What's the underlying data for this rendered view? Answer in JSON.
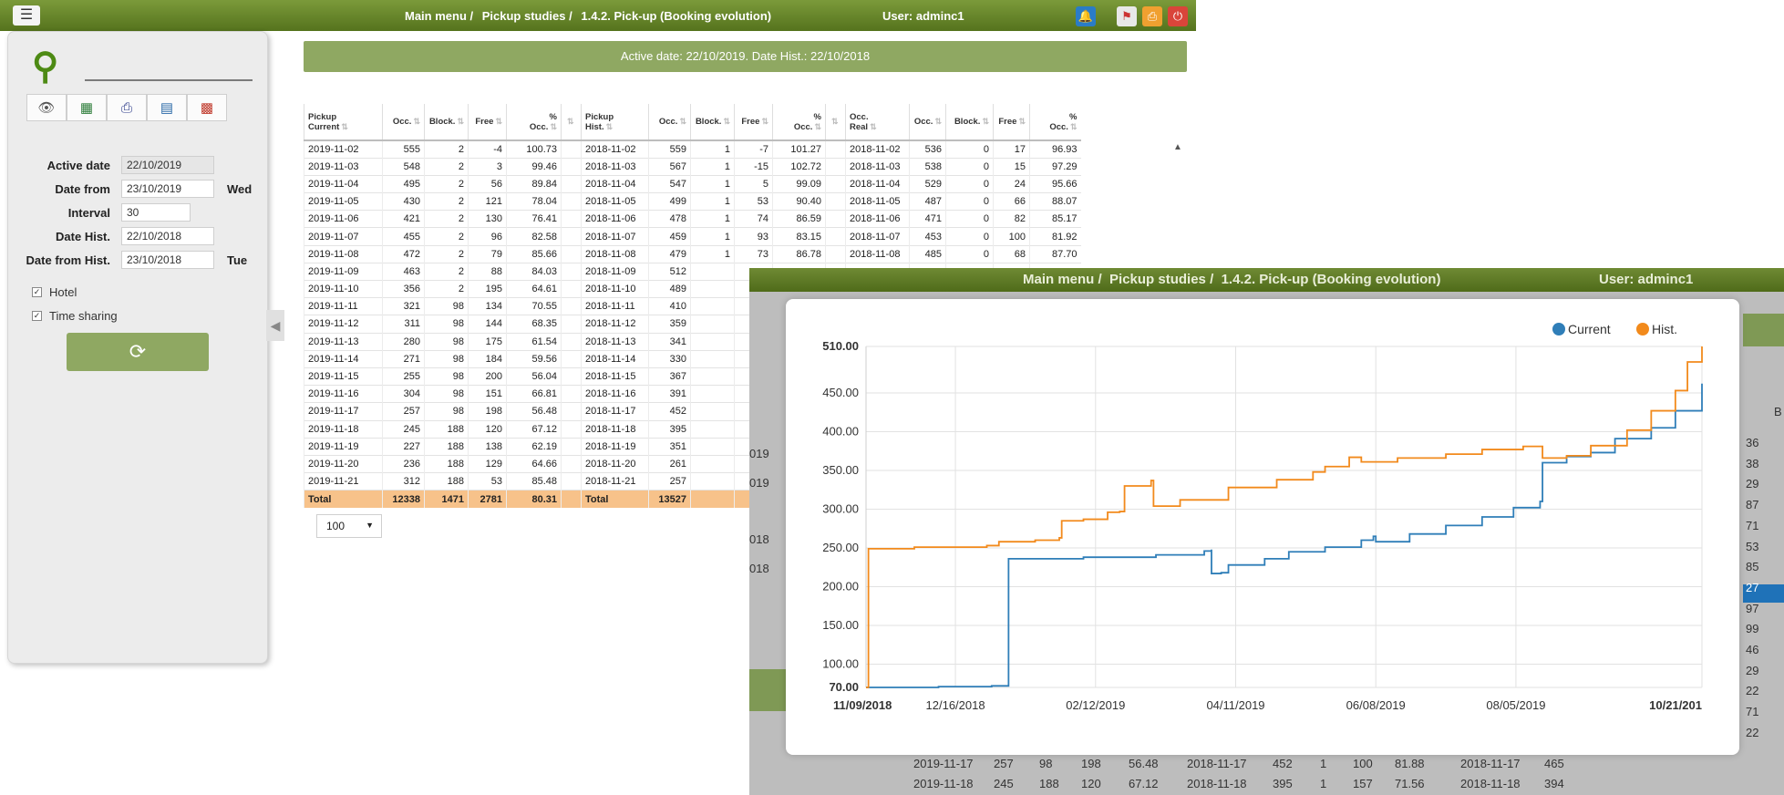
{
  "topbar": {
    "menu_icon": "hamburger-icon",
    "crumb_main": "Main menu /",
    "crumb_pickup": "Pickup studies /",
    "crumb_page": "1.4.2. Pick-up (Booking evolution)",
    "user": "User: adminc1",
    "icons": [
      "bell-icon",
      "flag-icon",
      "print-icon",
      "power-icon"
    ],
    "colors": {
      "bell": "#2a7cc7",
      "flag": "#e8e8e8",
      "print": "#f0a030",
      "power": "#d9453a"
    }
  },
  "filters": {
    "search_value": "",
    "toolbar_icons": [
      "eye-icon",
      "excel-icon",
      "printer-icon",
      "scanner-icon",
      "pdf-icon"
    ],
    "active_date_label": "Active date",
    "active_date": "22/10/2019",
    "date_from_label": "Date from",
    "date_from": "23/10/2019",
    "date_from_day": "Wed",
    "interval_label": "Interval",
    "interval": "30",
    "date_hist_label": "Date Hist.",
    "date_hist": "22/10/2018",
    "date_from_hist_label": "Date from Hist.",
    "date_from_hist": "23/10/2018",
    "date_from_hist_day": "Tue",
    "hotel_label": "Hotel",
    "timesharing_label": "Time sharing"
  },
  "banner": "Active date: 22/10/2019. Date Hist.: 22/10/2018",
  "table": {
    "headers": [
      [
        "Pickup",
        "Current"
      ],
      [
        "",
        "Occ."
      ],
      [
        "",
        "Block."
      ],
      [
        "",
        "Free"
      ],
      [
        "%",
        "Occ."
      ],
      [
        "",
        ""
      ],
      [
        "Pickup",
        "Hist."
      ],
      [
        "",
        "Occ."
      ],
      [
        "",
        "Block."
      ],
      [
        "",
        "Free"
      ],
      [
        "%",
        "Occ."
      ],
      [
        "",
        ""
      ],
      [
        "Occ.",
        "Real"
      ],
      [
        "",
        "Occ."
      ],
      [
        "",
        "Block."
      ],
      [
        "",
        "Free"
      ],
      [
        "%",
        "Occ."
      ]
    ],
    "rows": [
      [
        "2019-11-02",
        "555",
        "2",
        "-4",
        "100.73",
        "",
        "2018-11-02",
        "559",
        "1",
        "-7",
        "101.27",
        "",
        "2018-11-02",
        "536",
        "0",
        "17",
        "96.93"
      ],
      [
        "2019-11-03",
        "548",
        "2",
        "3",
        "99.46",
        "",
        "2018-11-03",
        "567",
        "1",
        "-15",
        "102.72",
        "",
        "2018-11-03",
        "538",
        "0",
        "15",
        "97.29"
      ],
      [
        "2019-11-04",
        "495",
        "2",
        "56",
        "89.84",
        "",
        "2018-11-04",
        "547",
        "1",
        "5",
        "99.09",
        "",
        "2018-11-04",
        "529",
        "0",
        "24",
        "95.66"
      ],
      [
        "2019-11-05",
        "430",
        "2",
        "121",
        "78.04",
        "",
        "2018-11-05",
        "499",
        "1",
        "53",
        "90.40",
        "",
        "2018-11-05",
        "487",
        "0",
        "66",
        "88.07"
      ],
      [
        "2019-11-06",
        "421",
        "2",
        "130",
        "76.41",
        "",
        "2018-11-06",
        "478",
        "1",
        "74",
        "86.59",
        "",
        "2018-11-06",
        "471",
        "0",
        "82",
        "85.17"
      ],
      [
        "2019-11-07",
        "455",
        "2",
        "96",
        "82.58",
        "",
        "2018-11-07",
        "459",
        "1",
        "93",
        "83.15",
        "",
        "2018-11-07",
        "453",
        "0",
        "100",
        "81.92"
      ],
      [
        "2019-11-08",
        "472",
        "2",
        "79",
        "85.66",
        "",
        "2018-11-08",
        "479",
        "1",
        "73",
        "86.78",
        "",
        "2018-11-08",
        "485",
        "0",
        "68",
        "87.70"
      ],
      [
        "2019-11-09",
        "463",
        "2",
        "88",
        "84.03",
        "",
        "2018-11-09",
        "512",
        "",
        "",
        "",
        "",
        "",
        "",
        "",
        "",
        ""
      ],
      [
        "2019-11-10",
        "356",
        "2",
        "195",
        "64.61",
        "",
        "2018-11-10",
        "489",
        "",
        "",
        "",
        "",
        "",
        "",
        "",
        "",
        ""
      ],
      [
        "2019-11-11",
        "321",
        "98",
        "134",
        "70.55",
        "",
        "2018-11-11",
        "410",
        "",
        "",
        "",
        "",
        "",
        "",
        "",
        "",
        ""
      ],
      [
        "2019-11-12",
        "311",
        "98",
        "144",
        "68.35",
        "",
        "2018-11-12",
        "359",
        "",
        "",
        "",
        "",
        "",
        "",
        "",
        "",
        ""
      ],
      [
        "2019-11-13",
        "280",
        "98",
        "175",
        "61.54",
        "",
        "2018-11-13",
        "341",
        "",
        "",
        "",
        "",
        "",
        "",
        "",
        "",
        ""
      ],
      [
        "2019-11-14",
        "271",
        "98",
        "184",
        "59.56",
        "",
        "2018-11-14",
        "330",
        "",
        "",
        "",
        "",
        "",
        "",
        "",
        "",
        ""
      ],
      [
        "2019-11-15",
        "255",
        "98",
        "200",
        "56.04",
        "",
        "2018-11-15",
        "367",
        "",
        "",
        "",
        "",
        "",
        "",
        "",
        "",
        ""
      ],
      [
        "2019-11-16",
        "304",
        "98",
        "151",
        "66.81",
        "",
        "2018-11-16",
        "391",
        "",
        "",
        "",
        "",
        "",
        "",
        "",
        "",
        ""
      ],
      [
        "2019-11-17",
        "257",
        "98",
        "198",
        "56.48",
        "",
        "2018-11-17",
        "452",
        "",
        "",
        "",
        "",
        "",
        "",
        "",
        "",
        ""
      ],
      [
        "2019-11-18",
        "245",
        "188",
        "120",
        "67.12",
        "",
        "2018-11-18",
        "395",
        "",
        "",
        "",
        "",
        "",
        "",
        "",
        "",
        ""
      ],
      [
        "2019-11-19",
        "227",
        "188",
        "138",
        "62.19",
        "",
        "2018-11-19",
        "351",
        "",
        "",
        "",
        "",
        "",
        "",
        "",
        "",
        ""
      ],
      [
        "2019-11-20",
        "236",
        "188",
        "129",
        "64.66",
        "",
        "2018-11-20",
        "261",
        "",
        "",
        "",
        "",
        "",
        "",
        "",
        "",
        ""
      ],
      [
        "2019-11-21",
        "312",
        "188",
        "53",
        "85.48",
        "",
        "2018-11-21",
        "257",
        "",
        "",
        "",
        "",
        "",
        "",
        "",
        "",
        ""
      ]
    ],
    "total": [
      "Total",
      "12338",
      "1471",
      "2781",
      "80.31",
      "",
      "Total",
      "13527",
      "",
      "",
      "",
      "",
      "",
      "",
      "",
      "",
      ""
    ],
    "page_size": "100"
  },
  "popup": {
    "crumb_main": "Main menu /",
    "crumb_pickup": "Pickup studies /",
    "crumb_page": "1.4.2. Pick-up (Booking evolution)",
    "user": "User: adminc1",
    "bg_left": [
      "019",
      "019",
      "018",
      "018"
    ],
    "bg_right": [
      "36",
      "38",
      "29",
      "87",
      "71",
      "53",
      "85",
      "27",
      "97",
      "99",
      "46",
      "29",
      "22",
      "71",
      "22"
    ],
    "bg_header_b": "B",
    "bg_rows": [
      [
        "2019-11-17",
        "257",
        "98",
        "198",
        "56.48",
        "2018-11-17",
        "452",
        "1",
        "100",
        "81.88",
        "2018-11-17",
        "465"
      ],
      [
        "2019-11-18",
        "245",
        "188",
        "120",
        "67.12",
        "2018-11-18",
        "395",
        "1",
        "157",
        "71.56",
        "2018-11-18",
        "394"
      ]
    ]
  },
  "chart_data": {
    "type": "line",
    "legend": [
      "Current",
      "Hist."
    ],
    "legend_position": "top-right",
    "colors": {
      "Current": "#2f7eb8",
      "Hist.": "#f28a1c"
    },
    "y_ticks": [
      "510.00",
      "450.00",
      "400.00",
      "350.00",
      "300.00",
      "250.00",
      "200.00",
      "150.00",
      "100.00",
      "70.00"
    ],
    "y_tick_values": [
      510,
      450,
      400,
      350,
      300,
      250,
      200,
      150,
      100,
      70
    ],
    "ylim": [
      70,
      510
    ],
    "x_ticks": [
      "11/09/2018",
      "12/16/2018",
      "02/12/2019",
      "04/11/2019",
      "06/08/2019",
      "08/05/2019",
      "10/21/201"
    ],
    "x_tick_days": [
      0,
      37,
      95,
      153,
      211,
      269,
      346
    ],
    "xlim_days": [
      0,
      346
    ],
    "grid": true,
    "series": [
      {
        "name": "Current",
        "points": [
          [
            0,
            70
          ],
          [
            10,
            70
          ],
          [
            30,
            71
          ],
          [
            52,
            72
          ],
          [
            58,
            72
          ],
          [
            59,
            236
          ],
          [
            90,
            238
          ],
          [
            120,
            241
          ],
          [
            140,
            246
          ],
          [
            143,
            248
          ],
          [
            143,
            217
          ],
          [
            147,
            218
          ],
          [
            150,
            228
          ],
          [
            165,
            236
          ],
          [
            175,
            245
          ],
          [
            190,
            251
          ],
          [
            205,
            260
          ],
          [
            210,
            265
          ],
          [
            211,
            258
          ],
          [
            225,
            268
          ],
          [
            240,
            279
          ],
          [
            255,
            290
          ],
          [
            268,
            302
          ],
          [
            279,
            310
          ],
          [
            280,
            360
          ],
          [
            290,
            368
          ],
          [
            300,
            373
          ],
          [
            310,
            391
          ],
          [
            325,
            405
          ],
          [
            335,
            427
          ],
          [
            346,
            462
          ]
        ]
      },
      {
        "name": "Hist.",
        "points": [
          [
            0,
            70
          ],
          [
            1,
            249
          ],
          [
            20,
            251
          ],
          [
            50,
            253
          ],
          [
            55,
            258
          ],
          [
            70,
            260
          ],
          [
            80,
            263
          ],
          [
            81,
            285
          ],
          [
            90,
            287
          ],
          [
            100,
            296
          ],
          [
            105,
            297
          ],
          [
            107,
            330
          ],
          [
            118,
            337
          ],
          [
            119,
            304
          ],
          [
            130,
            312
          ],
          [
            150,
            328
          ],
          [
            170,
            338
          ],
          [
            185,
            348
          ],
          [
            190,
            355
          ],
          [
            200,
            367
          ],
          [
            205,
            361
          ],
          [
            220,
            366
          ],
          [
            240,
            371
          ],
          [
            255,
            377
          ],
          [
            272,
            381
          ],
          [
            280,
            366
          ],
          [
            290,
            369
          ],
          [
            300,
            382
          ],
          [
            315,
            402
          ],
          [
            325,
            427
          ],
          [
            335,
            453
          ],
          [
            340,
            490
          ],
          [
            346,
            510
          ]
        ]
      }
    ]
  }
}
